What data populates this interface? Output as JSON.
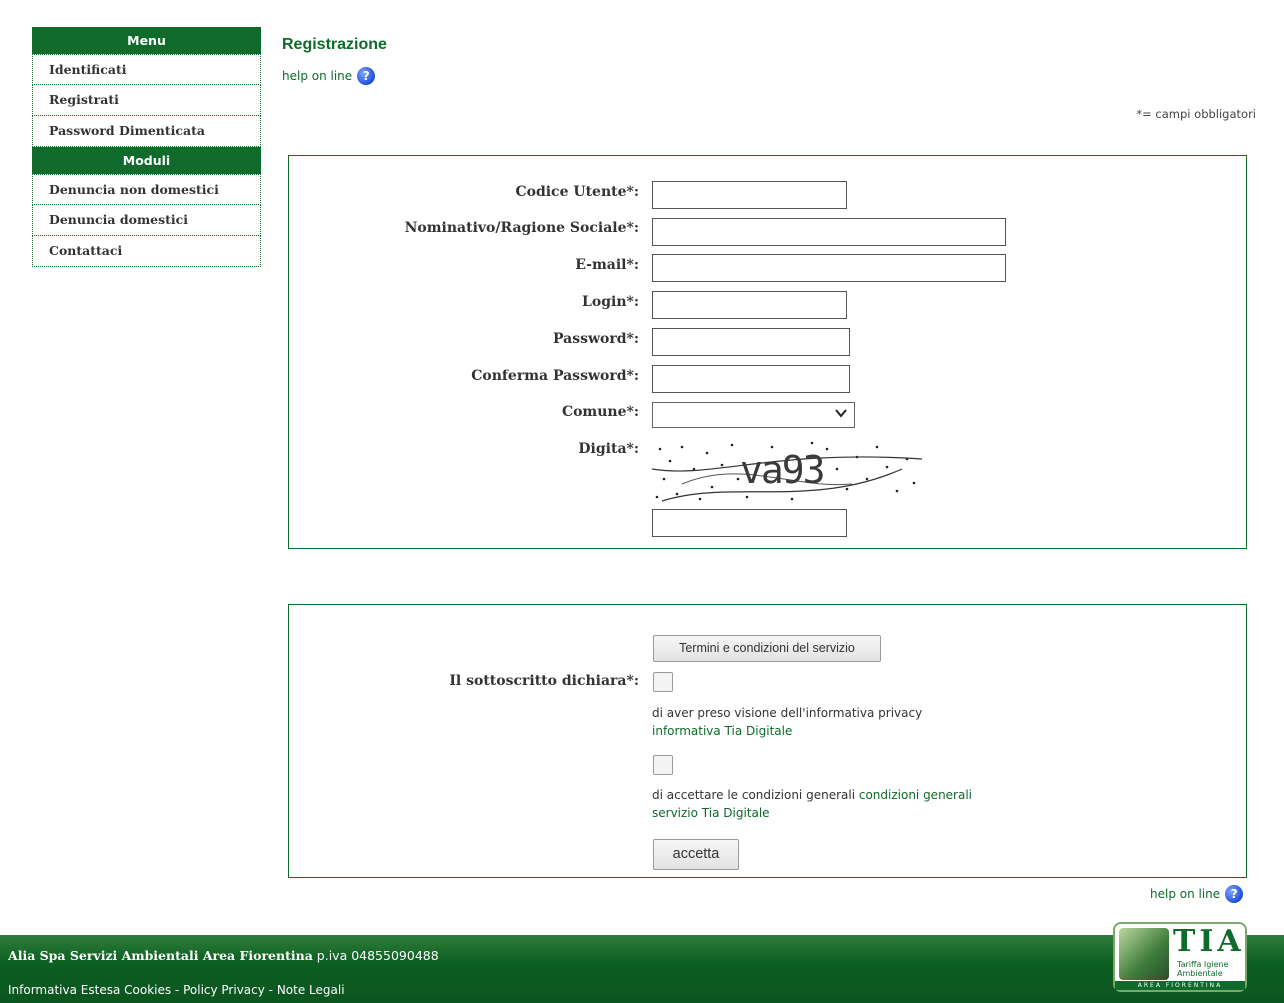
{
  "sidebar": {
    "menu_header": "Menu",
    "menu_items": [
      {
        "label": "Identificati"
      },
      {
        "label": "Registrati"
      },
      {
        "label": "Password Dimenticata"
      }
    ],
    "moduli_header": "Moduli",
    "moduli_items": [
      {
        "label": "Denuncia non domestici"
      },
      {
        "label": "Denuncia domestici"
      },
      {
        "label": "Contattaci"
      }
    ]
  },
  "header": {
    "title": "Registrazione",
    "help_label": "help on line",
    "required_note": "*= campi obbligatori"
  },
  "form": {
    "codice_utente_label": "Codice Utente*:",
    "nominativo_label": "Nominativo/Ragione Sociale*:",
    "email_label": "E-mail*:",
    "login_label": "Login*:",
    "password_label": "Password*:",
    "conferma_password_label": "Conferma Password*:",
    "comune_label": "Comune*:",
    "comune_value": "",
    "digita_label": "Digita*:",
    "captcha_text": "va93"
  },
  "terms": {
    "terms_button": "Termini e condizioni del servizio",
    "declare_label": "Il sottoscritto dichiara*:",
    "privacy_text": "di aver preso visione dell'informativa privacy",
    "privacy_link": "informativa Tia Digitale",
    "conditions_text": "di accettare le condizioni generali ",
    "conditions_link": "condizioni generali servizio Tia Digitale",
    "accept_button": "accetta"
  },
  "footer": {
    "company": "Alia Spa Servizi Ambientali Area Fiorentina",
    "piva": " p.iva 04855090488",
    "cookies": "Informativa Estesa Cookies",
    "separator": " - ",
    "privacy": "Policy Privacy",
    "legal": "Note Legali",
    "logo_text": "TIA",
    "logo_sub1": "Tariffa Igiene",
    "logo_sub2": "Ambientale",
    "logo_bar": "AREA FIORENTINA"
  },
  "icons": {
    "help": "question-circle-icon",
    "dropdown": "chevron-down-icon"
  },
  "colors": {
    "brand_green": "#0e6b2b",
    "help_blue": "#1f4fd6"
  }
}
